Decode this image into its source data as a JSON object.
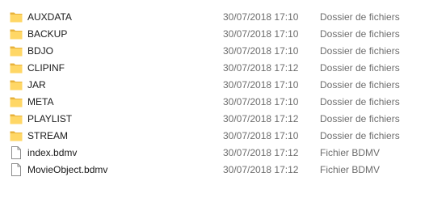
{
  "files": [
    {
      "name": "AUXDATA",
      "modified": "30/07/2018 17:10",
      "type": "Dossier de fichiers",
      "icon": "folder-icon"
    },
    {
      "name": "BACKUP",
      "modified": "30/07/2018 17:10",
      "type": "Dossier de fichiers",
      "icon": "folder-icon"
    },
    {
      "name": "BDJO",
      "modified": "30/07/2018 17:10",
      "type": "Dossier de fichiers",
      "icon": "folder-icon"
    },
    {
      "name": "CLIPINF",
      "modified": "30/07/2018 17:12",
      "type": "Dossier de fichiers",
      "icon": "folder-icon"
    },
    {
      "name": "JAR",
      "modified": "30/07/2018 17:10",
      "type": "Dossier de fichiers",
      "icon": "folder-icon"
    },
    {
      "name": "META",
      "modified": "30/07/2018 17:10",
      "type": "Dossier de fichiers",
      "icon": "folder-icon"
    },
    {
      "name": "PLAYLIST",
      "modified": "30/07/2018 17:12",
      "type": "Dossier de fichiers",
      "icon": "folder-icon"
    },
    {
      "name": "STREAM",
      "modified": "30/07/2018 17:10",
      "type": "Dossier de fichiers",
      "icon": "folder-icon"
    },
    {
      "name": "index.bdmv",
      "modified": "30/07/2018 17:12",
      "type": "Fichier BDMV",
      "icon": "file-icon"
    },
    {
      "name": "MovieObject.bdmv",
      "modified": "30/07/2018 17:12",
      "type": "Fichier BDMV",
      "icon": "file-icon"
    }
  ],
  "colors": {
    "folder_body": "#ffd766",
    "folder_back": "#e8b23b",
    "file_border": "#8c8c8c",
    "secondary_text": "#6d6d6d"
  }
}
